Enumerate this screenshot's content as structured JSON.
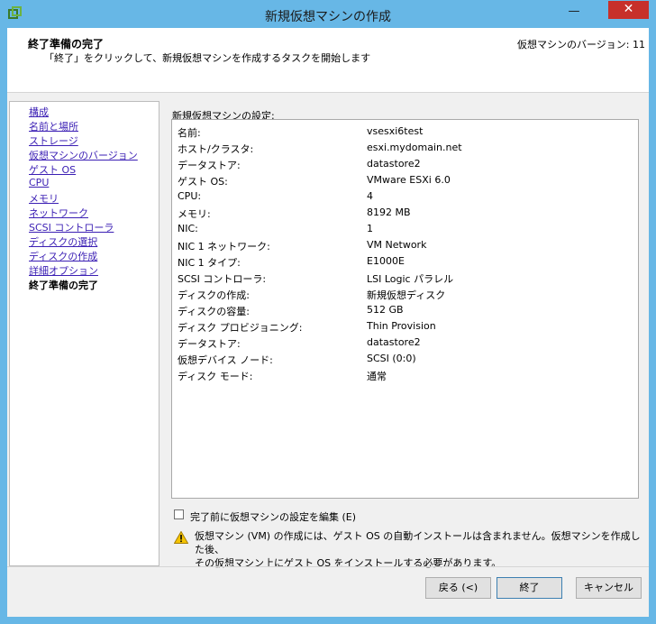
{
  "window": {
    "title": "新規仮想マシンの作成",
    "minimize_glyph": "—",
    "close_glyph": "✕"
  },
  "header": {
    "title": "終了準備の完了",
    "description": "「終了」をクリックして、新規仮想マシンを作成するタスクを開始します",
    "version": "仮想マシンのバージョン: 11"
  },
  "nav": {
    "items": [
      {
        "label": "構成",
        "current": false
      },
      {
        "label": "名前と場所",
        "current": false
      },
      {
        "label": "ストレージ",
        "current": false
      },
      {
        "label": "仮想マシンのバージョン",
        "current": false
      },
      {
        "label": "ゲスト OS",
        "current": false
      },
      {
        "label": "CPU",
        "current": false
      },
      {
        "label": "メモリ",
        "current": false
      },
      {
        "label": "ネットワーク",
        "current": false
      },
      {
        "label": "SCSI コントローラ",
        "current": false
      },
      {
        "label": "ディスクの選択",
        "current": false
      },
      {
        "label": "ディスクの作成",
        "current": false
      },
      {
        "label": "詳細オプション",
        "current": false
      },
      {
        "label": "終了準備の完了",
        "current": true
      }
    ]
  },
  "settings": {
    "section_label": "新規仮想マシンの設定:",
    "rows": [
      {
        "label": "名前:",
        "value": "vsesxi6test"
      },
      {
        "label": "ホスト/クラスタ:",
        "value": "esxi.mydomain.net"
      },
      {
        "label": "データストア:",
        "value": "datastore2"
      },
      {
        "label": "ゲスト OS:",
        "value": "VMware ESXi 6.0"
      },
      {
        "label": "CPU:",
        "value": "4"
      },
      {
        "label": "メモリ:",
        "value": "8192 MB"
      },
      {
        "label": "NIC:",
        "value": "1"
      },
      {
        "label": "NIC 1 ネットワーク:",
        "value": "VM Network"
      },
      {
        "label": "NIC 1 タイプ:",
        "value": "E1000E"
      },
      {
        "label": "SCSI コントローラ:",
        "value": "LSI Logic パラレル"
      },
      {
        "label": "ディスクの作成:",
        "value": "新規仮想ディスク"
      },
      {
        "label": "ディスクの容量:",
        "value": "512 GB"
      },
      {
        "label": "ディスク プロビジョニング:",
        "value": "Thin Provision"
      },
      {
        "label": "データストア:",
        "value": "datastore2"
      },
      {
        "label": "仮想デバイス ノード:",
        "value": "SCSI (0:0)"
      },
      {
        "label": "ディスク モード:",
        "value": "通常"
      }
    ]
  },
  "edit_before_finish": {
    "label": "完了前に仮想マシンの設定を編集 (E)",
    "checked": false
  },
  "warning": {
    "icon": "warning-icon",
    "line1": "仮想マシン (VM) の作成には、ゲスト OS の自動インストールは含まれません。仮想マシンを作成した後、",
    "line2": "その仮想マシン上にゲスト OS をインストールする必要があります。"
  },
  "buttons": {
    "back": "戻る (<)",
    "finish": "終了",
    "cancel": "キャンセル"
  },
  "colors": {
    "window_frame": "#67b7e6",
    "close_button": "#c7302a",
    "link": "#3b1fb4"
  }
}
